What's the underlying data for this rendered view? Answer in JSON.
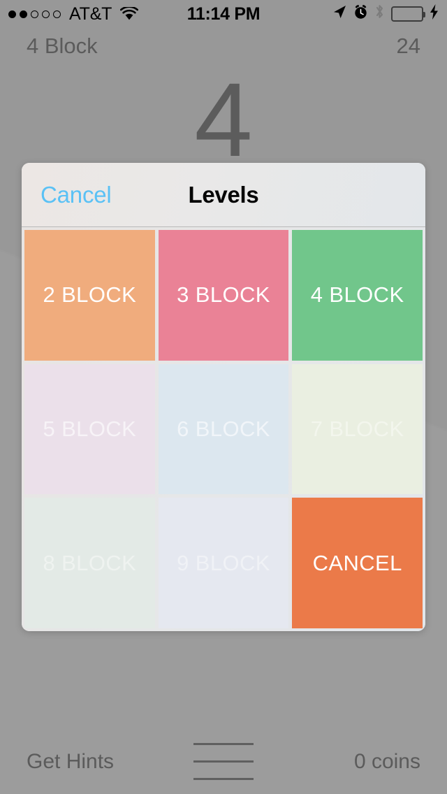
{
  "status_bar": {
    "signal_dots_total": 5,
    "signal_dots_filled": 2,
    "carrier": "AT&T",
    "wifi_icon": "wifi-icon",
    "time": "11:14 PM",
    "location_icon": "location-arrow-icon",
    "alarm_icon": "alarm-clock-icon",
    "bluetooth_icon": "bluetooth-icon",
    "battery_icon": "battery-icon",
    "battery_level_percent": 100,
    "battery_color": "#2f9e44",
    "charging_icon": "lightning-bolt-icon"
  },
  "game": {
    "level_name": "4 Block",
    "score": "24",
    "current_digit": "4"
  },
  "bottom_bar": {
    "hints_label": "Get Hints",
    "menu_icon": "hamburger-menu-icon",
    "coins_label": "0 coins"
  },
  "modal": {
    "cancel_label": "Cancel",
    "title": "Levels",
    "tiles": [
      {
        "label": "2 BLOCK",
        "color": "#f0ac7d",
        "locked": false
      },
      {
        "label": "3 BLOCK",
        "color": "#ea8296",
        "locked": false
      },
      {
        "label": "4 BLOCK",
        "color": "#71c68b",
        "locked": false
      },
      {
        "label": "5 BLOCK",
        "color": "#c98fb8",
        "locked": true
      },
      {
        "label": "6 BLOCK",
        "color": "#7fb5cf",
        "locked": true
      },
      {
        "label": "7 BLOCK",
        "color": "#c3d98e",
        "locked": true,
        "very_faded": true
      },
      {
        "label": "8 BLOCK",
        "color": "#9fc2a3",
        "locked": true,
        "very_faded": true
      },
      {
        "label": "9 BLOCK",
        "color": "#a9b8d4",
        "locked": true,
        "very_faded": true
      },
      {
        "label": "CANCEL",
        "color": "#eb7a49",
        "locked": false
      }
    ]
  }
}
